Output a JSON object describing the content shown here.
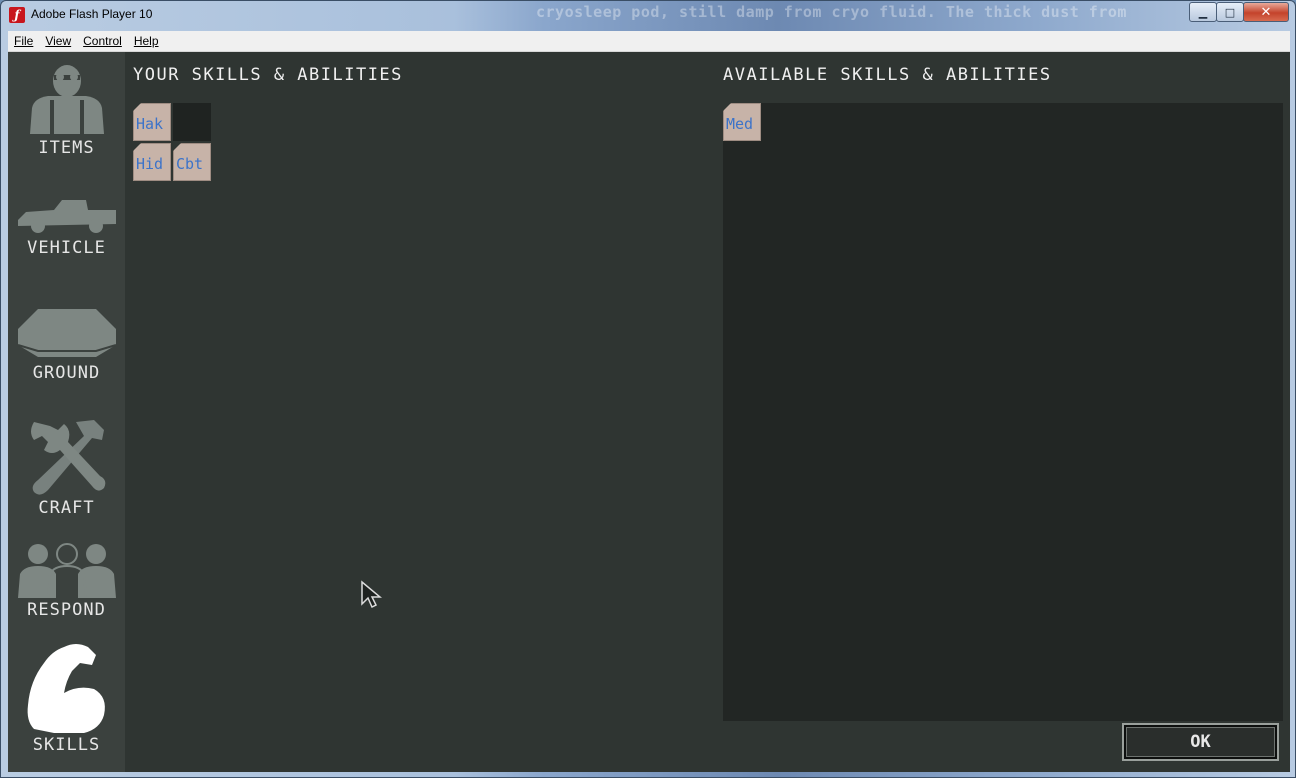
{
  "window": {
    "title": "Adobe Flash Player 10",
    "background_text": "cryosleep pod, still damp from cryo fluid. The thick dust from"
  },
  "menu": [
    "File",
    "View",
    "Control",
    "Help"
  ],
  "sidebar": {
    "items": [
      {
        "label": "ITEMS"
      },
      {
        "label": "VEHICLE"
      },
      {
        "label": "GROUND"
      },
      {
        "label": "CRAFT"
      },
      {
        "label": "RESPOND"
      },
      {
        "label": "SKILLS",
        "active": true
      }
    ]
  },
  "your_skills": {
    "heading": "YOUR SKILLS & ABILITIES",
    "skills": [
      "Hak",
      "Hid",
      "Cbt"
    ]
  },
  "available_skills": {
    "heading": "AVAILABLE SKILLS & ABILITIES",
    "skills": [
      "Med"
    ]
  },
  "ok_label": "OK",
  "colors": {
    "content_bg": "#2f3532",
    "sidebar_bg": "#3b413e",
    "skill_tile": "#c7b3a8",
    "skill_text": "#3c73c9"
  }
}
